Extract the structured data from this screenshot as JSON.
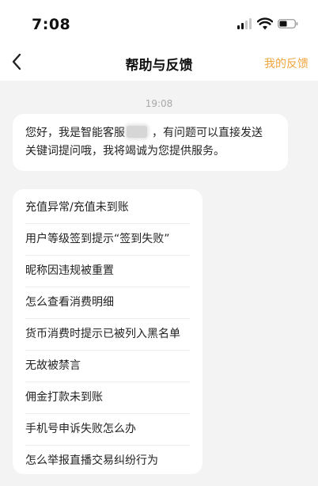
{
  "status_bar": {
    "time": "7:08"
  },
  "nav": {
    "back_icon": "chevron-left-icon",
    "title": "帮助与反馈",
    "feedback_label": "我的反馈",
    "accent_color": "#f0a43c"
  },
  "chat": {
    "timestamp": "19:08",
    "welcome_line1_before": "您好，我是智能客服",
    "welcome_line1_after": "，有问题可以直接发送",
    "welcome_line2": "关键词提问哦，我将竭诚为您提供服务。"
  },
  "faq": {
    "items": [
      {
        "label": "充值异常/充值未到账"
      },
      {
        "label": "用户等级签到提示“签到失败”"
      },
      {
        "label": "昵称因违规被重置"
      },
      {
        "label": "怎么查看消费明细"
      },
      {
        "label": "货币消费时提示已被列入黑名单"
      },
      {
        "label": "无故被禁言"
      },
      {
        "label": "佣金打款未到账"
      },
      {
        "label": "手机号申诉失败怎么办"
      },
      {
        "label": "怎么举报直播交易纠纷行为"
      }
    ]
  }
}
